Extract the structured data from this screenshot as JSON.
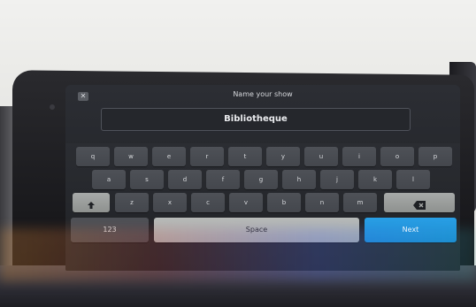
{
  "screen": {
    "title": "Name your show",
    "name_value": "Bibliotheque"
  },
  "keyboard": {
    "row1": [
      "q",
      "w",
      "e",
      "r",
      "t",
      "y",
      "u",
      "i",
      "o",
      "p"
    ],
    "row2": [
      "a",
      "s",
      "d",
      "f",
      "g",
      "h",
      "j",
      "k",
      "l"
    ],
    "row3": [
      "z",
      "x",
      "c",
      "v",
      "b",
      "n",
      "m"
    ],
    "numbers_label": "123",
    "space_label": "Space",
    "next_label": "Next"
  },
  "icons": {
    "close": "close-icon",
    "shift": "shift-arrow-icon",
    "backspace": "backspace-icon"
  },
  "colors": {
    "next_key": "#1586cf",
    "screen_bg": "#26282d"
  }
}
